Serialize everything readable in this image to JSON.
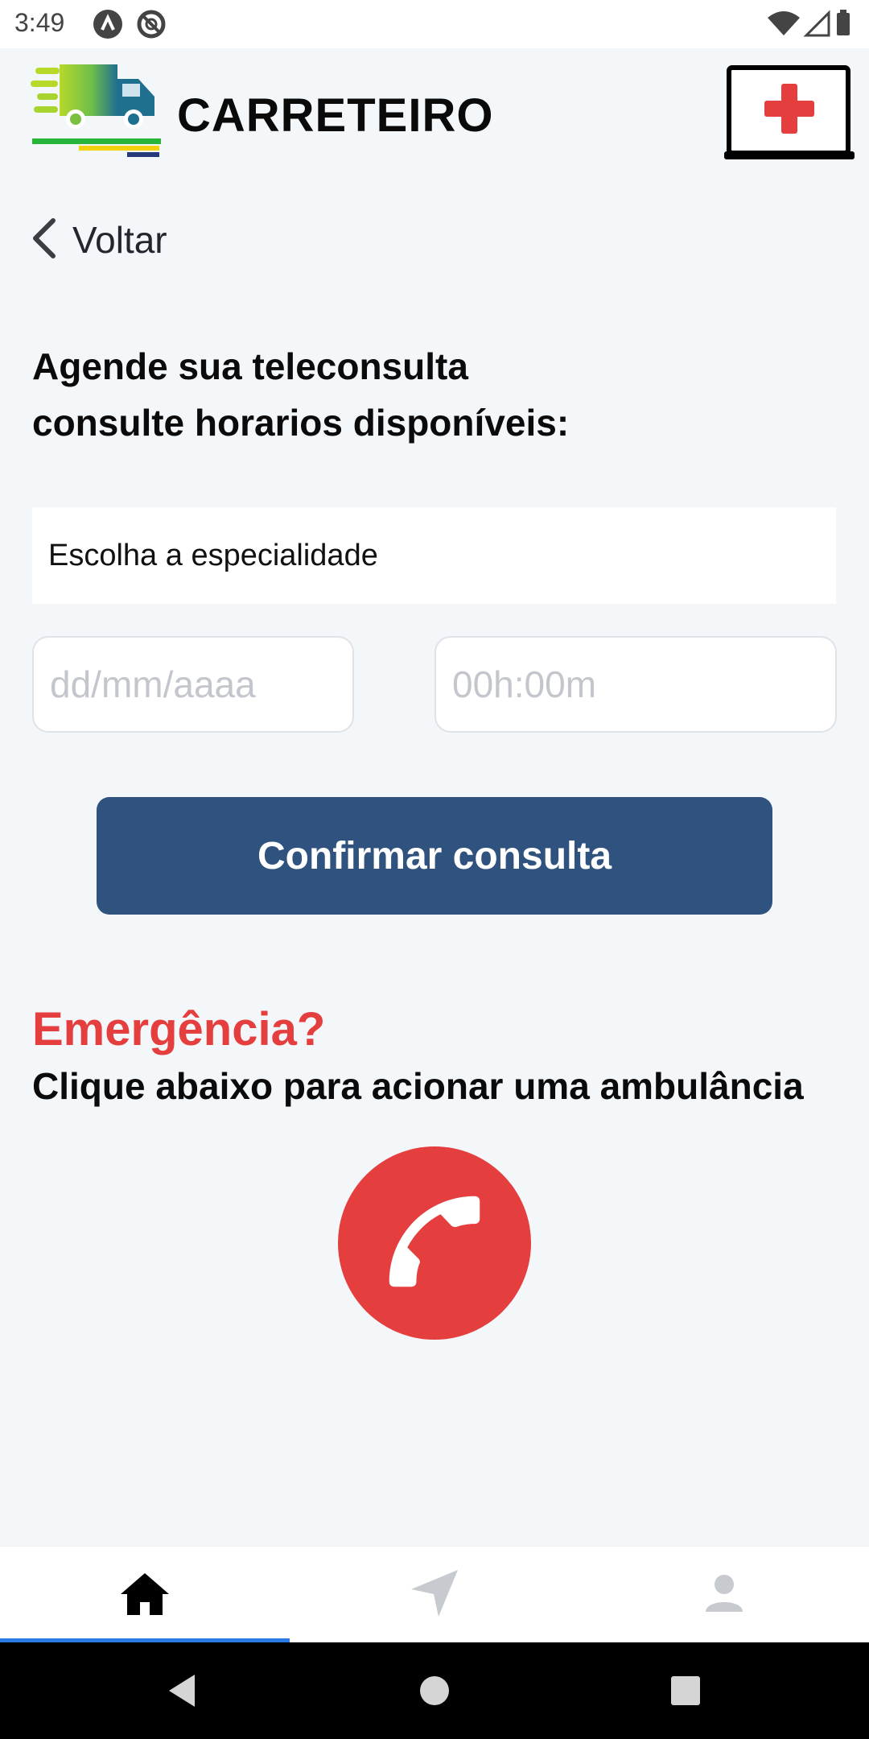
{
  "status_bar": {
    "time": "3:49",
    "left_icons": [
      "a-app-icon",
      "blocked-circle-icon"
    ],
    "right_icons": [
      "wifi-icon",
      "signal-icon",
      "battery-icon"
    ]
  },
  "header": {
    "logo_icon": "delivery-truck-logo",
    "title": "CARRETEIRO",
    "action_icon": "medical-laptop-plus-icon"
  },
  "back": {
    "label": "Voltar",
    "icon": "chevron-left-icon"
  },
  "headline": {
    "line1": "Agende sua teleconsulta",
    "line2": "consulte horarios disponíveis:"
  },
  "form": {
    "specialty_label": "Escolha a especialidade",
    "date_value": "",
    "date_placeholder": "dd/mm/aaaa",
    "time_value": "",
    "time_placeholder": "00h:00m",
    "confirm_label": "Confirmar consulta"
  },
  "emergency": {
    "title": "Emergência?",
    "subtitle": "Clique abaixo para acionar uma ambulância",
    "call_icon": "phone-icon"
  },
  "tabs": [
    {
      "icon": "home-icon",
      "active": true
    },
    {
      "icon": "navigation-arrow-icon",
      "active": false
    },
    {
      "icon": "user-icon",
      "active": false
    }
  ],
  "nav_bar": [
    "back-triangle-icon",
    "home-circle-icon",
    "recents-square-icon"
  ],
  "colors": {
    "background": "#f4f7fa",
    "primary": "#2f527f",
    "emergency": "#e53e3e",
    "tab_indicator": "#2b7be4"
  }
}
